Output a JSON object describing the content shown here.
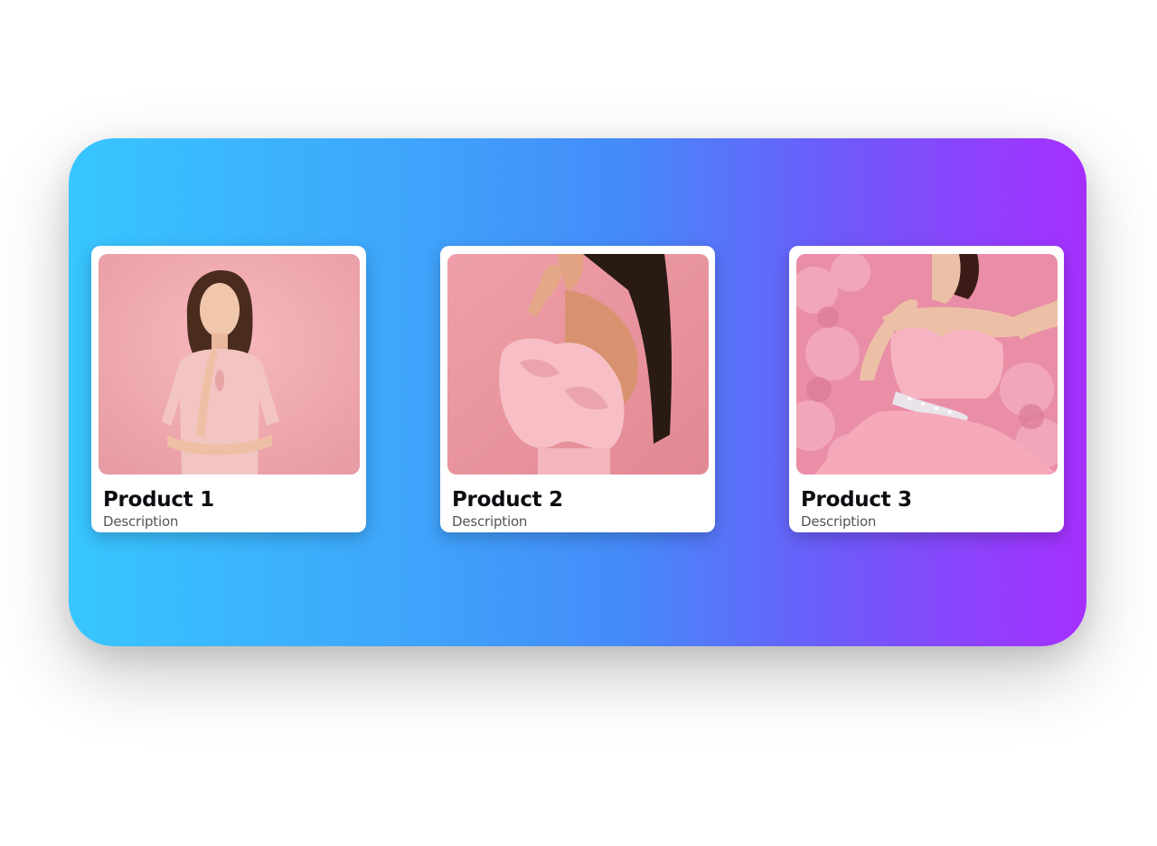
{
  "banner": {
    "gradient_start": "#38c6ff",
    "gradient_mid": "#458af9",
    "gradient_end": "#a62ffe"
  },
  "products": [
    {
      "title": "Product 1",
      "description": "Description",
      "image_icon": "woman-pink-top-photo"
    },
    {
      "title": "Product 2",
      "description": "Description",
      "image_icon": "woman-ruffle-dress-photo"
    },
    {
      "title": "Product 3",
      "description": "Description",
      "image_icon": "woman-pink-gown-photo"
    }
  ]
}
